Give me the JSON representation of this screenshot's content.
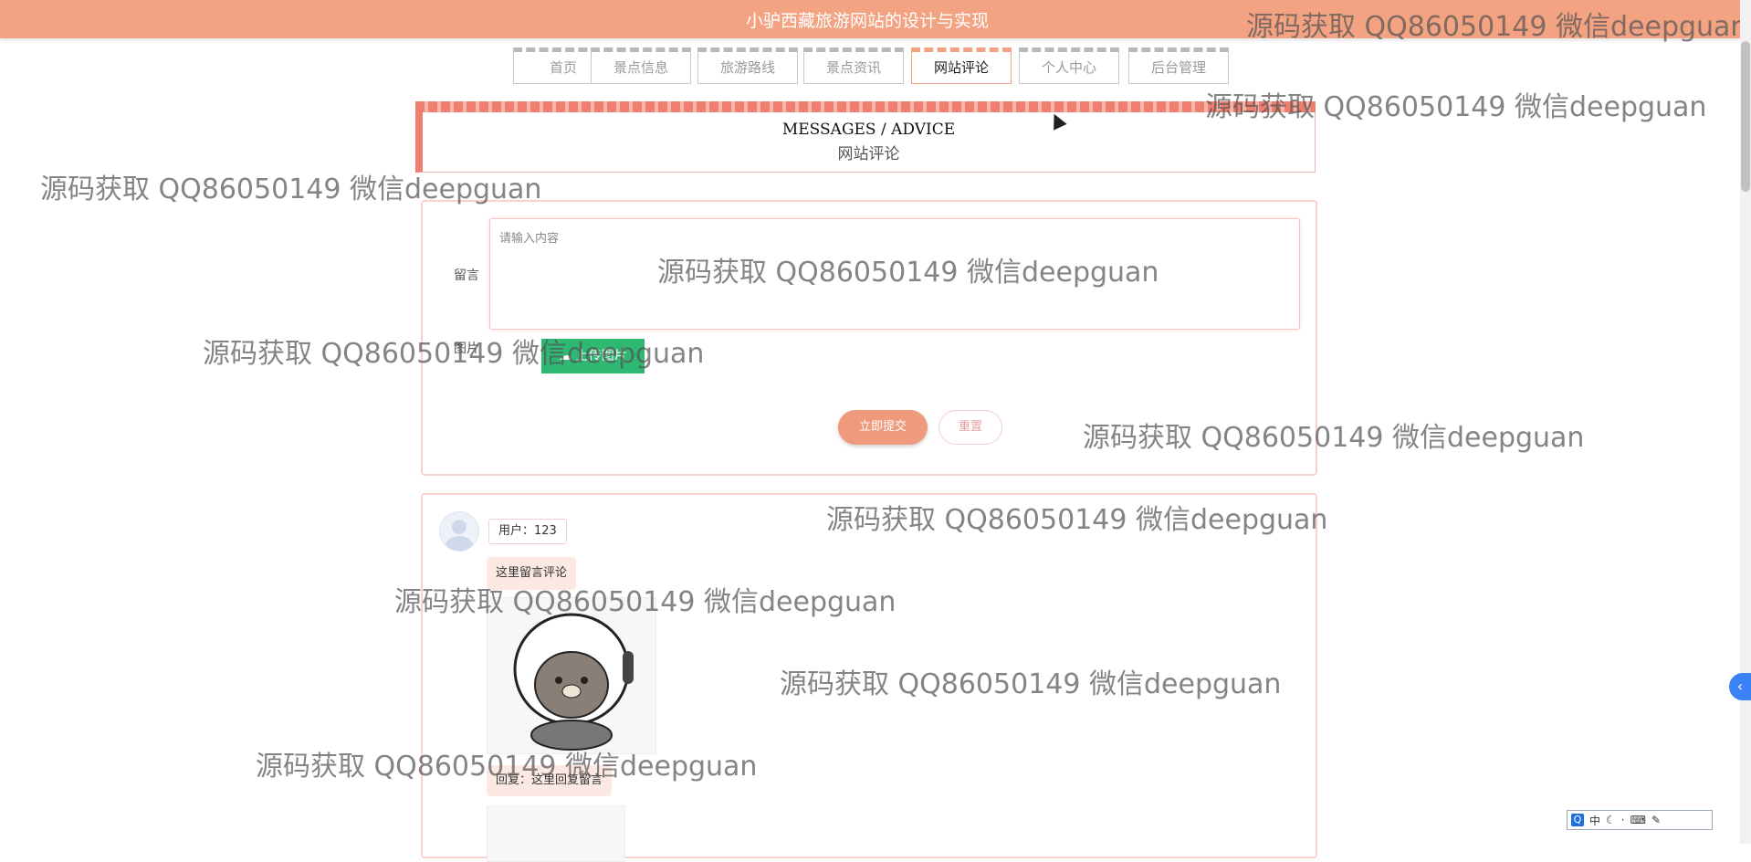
{
  "site": {
    "title": "小驴西藏旅游网站的设计与实现"
  },
  "nav": {
    "items": [
      {
        "label": "首页",
        "active": false
      },
      {
        "label": "景点信息",
        "active": false
      },
      {
        "label": "旅游路线",
        "active": false
      },
      {
        "label": "景点资讯",
        "active": false
      },
      {
        "label": "网站评论",
        "active": true
      },
      {
        "label": "个人中心",
        "active": false
      },
      {
        "label": "后台管理",
        "active": false
      }
    ]
  },
  "header": {
    "en": "MESSAGES / ADVICE",
    "cn": "网站评论"
  },
  "form": {
    "message_label": "留言",
    "message_placeholder": "请输入内容",
    "image_label": "图片",
    "upload_label": "上传图片",
    "submit_label": "立即提交",
    "reset_label": "重置"
  },
  "comment": {
    "user_tag": "用户：123",
    "content": "这里留言评论",
    "reply": "回复：这里回复留言"
  },
  "watermark": "源码获取 QQ86050149 微信deepguan",
  "ime": {
    "logo": "Q",
    "mode": "中"
  },
  "colors": {
    "brand": "#f3a382",
    "accent": "#ef7e6f",
    "upload": "#2eb872"
  }
}
